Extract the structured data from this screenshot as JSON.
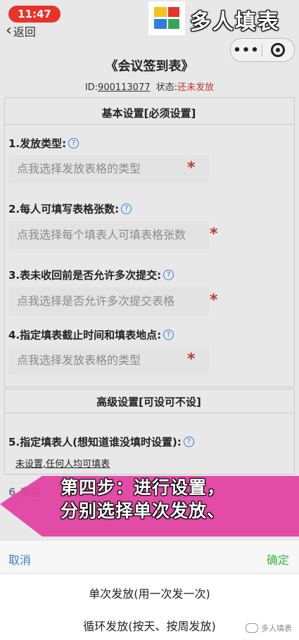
{
  "status_bar": {
    "time": "11:47"
  },
  "nav": {
    "back_label": "返回"
  },
  "brand": {
    "name": "多人填表",
    "watermark": "多人填表"
  },
  "page": {
    "title": "《会议签到表》",
    "id_label": "ID:",
    "id_value": "900113077",
    "status_label": "状态:",
    "status_value": "还未发放"
  },
  "basic_section": {
    "heading": "基本设置[必须设置]",
    "fields": [
      {
        "label": "1.发放类型:",
        "placeholder": "点我选择发放表格的类型",
        "required": "*"
      },
      {
        "label": "2.每人可填写表格张数:",
        "placeholder": "点我选择每个填表人可填表格张数",
        "required": "*"
      },
      {
        "label": "3.表未收回前是否允许多次提交:",
        "placeholder": "点我选择是否允许多次提交表格",
        "required": "*"
      },
      {
        "label": "4.指定填表截止时间和填表地点:",
        "placeholder": "点我选择发放表格的类型",
        "required": "*"
      }
    ]
  },
  "advanced_section": {
    "heading": "高级设置[可设可不设]",
    "field5_label": "5.指定填表人(想知道谁没填时设置):",
    "field5_value": "未设置,任何人均可填表",
    "field6_partial": "6.表格"
  },
  "overlay": {
    "line1": "第四步：进行设置，",
    "line2": "分别选择单次发放、",
    "color": "#e23ea0"
  },
  "picker": {
    "cancel": "取消",
    "confirm": "确定",
    "options": [
      "单次发放(用一次发一次)",
      "循环发放(按天、按周发放)"
    ]
  },
  "colors": {
    "accent_blue": "#3a7bd5",
    "required_red": "#c0392b",
    "confirm_green": "#3bb44a",
    "status_red": "#e8332b"
  }
}
